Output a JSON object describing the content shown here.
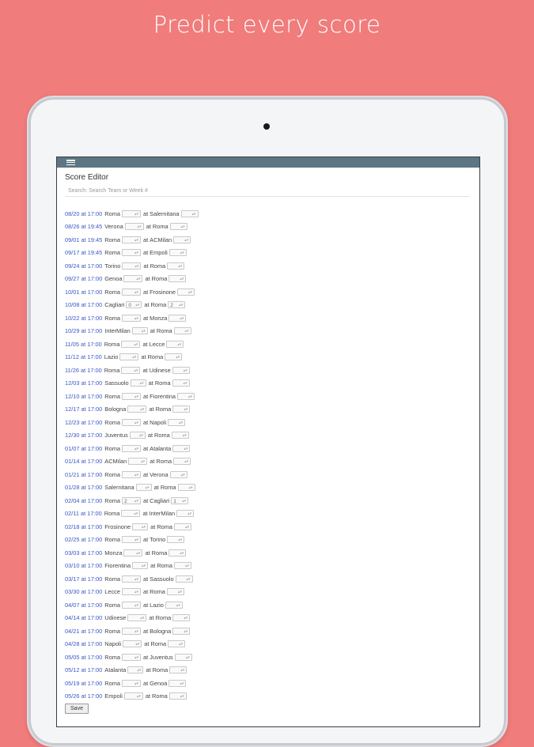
{
  "headline": "Predict every score",
  "editor": {
    "title": "Score Editor",
    "search_placeholder": "Search: Search Team or Week #",
    "save_label": "Save"
  },
  "games": [
    {
      "date": "08/20 at 17:00",
      "home": "Roma",
      "home_score": "",
      "away": "Salernitana",
      "away_score": ""
    },
    {
      "date": "08/26 at 19:45",
      "home": "Verona",
      "home_score": "",
      "away": "Roma",
      "away_score": ""
    },
    {
      "date": "09/01 at 19:45",
      "home": "Roma",
      "home_score": "",
      "away": "ACMilan",
      "away_score": ""
    },
    {
      "date": "09/17 at 19:45",
      "home": "Roma",
      "home_score": "",
      "away": "Empoli",
      "away_score": ""
    },
    {
      "date": "09/24 at 17:00",
      "home": "Torino",
      "home_score": "",
      "away": "Roma",
      "away_score": ""
    },
    {
      "date": "09/27 at 17:00",
      "home": "Genoa",
      "home_score": "",
      "away": "Roma",
      "away_score": ""
    },
    {
      "date": "10/01 at 17:00",
      "home": "Roma",
      "home_score": "",
      "away": "Frosinone",
      "away_score": ""
    },
    {
      "date": "10/08 at 17:00",
      "home": "Cagliari",
      "home_score": "0",
      "away": "Roma",
      "away_score": "2"
    },
    {
      "date": "10/22 at 17:00",
      "home": "Roma",
      "home_score": "",
      "away": "Monza",
      "away_score": ""
    },
    {
      "date": "10/29 at 17:00",
      "home": "InterMilan",
      "home_score": "",
      "away": "Roma",
      "away_score": ""
    },
    {
      "date": "11/05 at 17:00",
      "home": "Roma",
      "home_score": "",
      "away": "Lecce",
      "away_score": ""
    },
    {
      "date": "11/12 at 17:00",
      "home": "Lazio",
      "home_score": "",
      "away": "Roma",
      "away_score": ""
    },
    {
      "date": "11/26 at 17:00",
      "home": "Roma",
      "home_score": "",
      "away": "Udinese",
      "away_score": ""
    },
    {
      "date": "12/03 at 17:00",
      "home": "Sassuolo",
      "home_score": "",
      "away": "Roma",
      "away_score": ""
    },
    {
      "date": "12/10 at 17:00",
      "home": "Roma",
      "home_score": "",
      "away": "Fiorentina",
      "away_score": ""
    },
    {
      "date": "12/17 at 17:00",
      "home": "Bologna",
      "home_score": "",
      "away": "Roma",
      "away_score": ""
    },
    {
      "date": "12/23 at 17:00",
      "home": "Roma",
      "home_score": "",
      "away": "Napoli",
      "away_score": ""
    },
    {
      "date": "12/30 at 17:00",
      "home": "Juventus",
      "home_score": "",
      "away": "Roma",
      "away_score": ""
    },
    {
      "date": "01/07 at 17:00",
      "home": "Roma",
      "home_score": "",
      "away": "Atalanta",
      "away_score": ""
    },
    {
      "date": "01/14 at 17:00",
      "home": "ACMilan",
      "home_score": "",
      "away": "Roma",
      "away_score": ""
    },
    {
      "date": "01/21 at 17:00",
      "home": "Roma",
      "home_score": "",
      "away": "Verona",
      "away_score": ""
    },
    {
      "date": "01/28 at 17:00",
      "home": "Salernitana",
      "home_score": "",
      "away": "Roma",
      "away_score": ""
    },
    {
      "date": "02/04 at 17:00",
      "home": "Roma",
      "home_score": "2",
      "away": "Cagliari",
      "away_score": "1"
    },
    {
      "date": "02/11 at 17:00",
      "home": "Roma",
      "home_score": "",
      "away": "InterMilan",
      "away_score": ""
    },
    {
      "date": "02/18 at 17:00",
      "home": "Frosinone",
      "home_score": "",
      "away": "Roma",
      "away_score": ""
    },
    {
      "date": "02/25 at 17:00",
      "home": "Roma",
      "home_score": "",
      "away": "Torino",
      "away_score": ""
    },
    {
      "date": "03/03 at 17:00",
      "home": "Monza",
      "home_score": "",
      "away": "Roma",
      "away_score": ""
    },
    {
      "date": "03/10 at 17:00",
      "home": "Fiorentina",
      "home_score": "",
      "away": "Roma",
      "away_score": ""
    },
    {
      "date": "03/17 at 17:00",
      "home": "Roma",
      "home_score": "",
      "away": "Sassuolo",
      "away_score": ""
    },
    {
      "date": "03/30 at 17:00",
      "home": "Lecce",
      "home_score": "",
      "away": "Roma",
      "away_score": ""
    },
    {
      "date": "04/07 at 17:00",
      "home": "Roma",
      "home_score": "",
      "away": "Lazio",
      "away_score": ""
    },
    {
      "date": "04/14 at 17:00",
      "home": "Udinese",
      "home_score": "",
      "away": "Roma",
      "away_score": ""
    },
    {
      "date": "04/21 at 17:00",
      "home": "Roma",
      "home_score": "",
      "away": "Bologna",
      "away_score": ""
    },
    {
      "date": "04/28 at 17:00",
      "home": "Napoli",
      "home_score": "",
      "away": "Roma",
      "away_score": ""
    },
    {
      "date": "05/05 at 17:00",
      "home": "Roma",
      "home_score": "",
      "away": "Juventus",
      "away_score": ""
    },
    {
      "date": "05/12 at 17:00",
      "home": "Atalanta",
      "home_score": "",
      "away": "Roma",
      "away_score": ""
    },
    {
      "date": "05/19 at 17:00",
      "home": "Roma",
      "home_score": "",
      "away": "Genoa",
      "away_score": ""
    },
    {
      "date": "05/26 at 17:00",
      "home": "Empoli",
      "home_score": "",
      "away": "Roma",
      "away_score": ""
    }
  ]
}
